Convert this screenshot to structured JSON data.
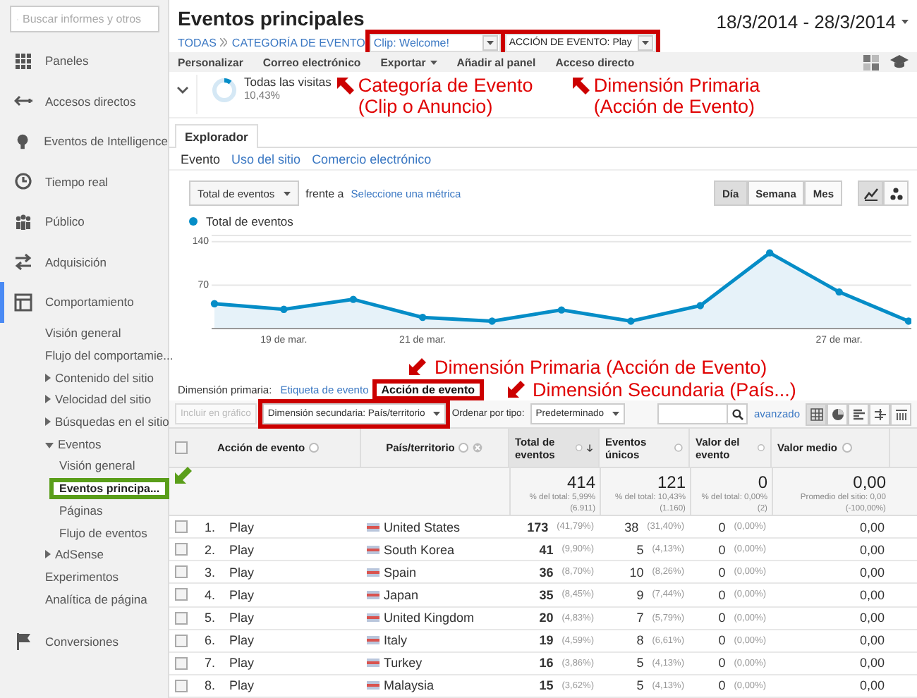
{
  "sidebar": {
    "search": {
      "placeholder": "Buscar informes y otros"
    },
    "items": [
      {
        "label": "Paneles",
        "selected": false
      },
      {
        "label": "Accesos directos",
        "selected": false
      },
      {
        "label": "Eventos de Intelligence",
        "selected": false
      },
      {
        "label": "Tiempo real",
        "selected": false
      },
      {
        "label": "Público",
        "selected": false
      },
      {
        "label": "Adquisición",
        "selected": false
      },
      {
        "label": "Comportamiento",
        "selected": true,
        "children": [
          {
            "label": "Visión general",
            "selected": false
          },
          {
            "label": "Flujo del comportamie...",
            "selected": false
          },
          {
            "label": "Contenido del sitio",
            "selected": false,
            "expanded": false
          },
          {
            "label": "Velocidad del sitio",
            "selected": false,
            "expanded": false
          },
          {
            "label": "Búsquedas en el sitio",
            "selected": false,
            "expanded": false
          },
          {
            "label": "Eventos",
            "selected": false,
            "expanded": true,
            "children": [
              {
                "label": "Visión general",
                "selected": false
              },
              {
                "label": "Eventos principa...",
                "selected": true,
                "highlighted": true
              },
              {
                "label": "Páginas",
                "selected": false
              },
              {
                "label": "Flujo de eventos",
                "selected": false
              }
            ]
          },
          {
            "label": "AdSense",
            "selected": false,
            "expanded": false
          },
          {
            "label": "Experimentos",
            "selected": false
          },
          {
            "label": "Analítica de página",
            "selected": false
          }
        ]
      },
      {
        "label": "Conversiones",
        "selected": false
      }
    ]
  },
  "header": {
    "title": "Eventos principales",
    "date_range": "18/3/2014 - 28/3/2014",
    "breadcrumb": [
      {
        "label": "TODAS",
        "kind": "link",
        "highlighted": false
      },
      {
        "label": "CATEGORÍA DE EVENTO",
        "kind": "link",
        "highlighted": false
      },
      {
        "label": "Clip: Welcome!",
        "kind": "dropdown",
        "highlighted": true
      },
      {
        "label": "ACCIÓN DE EVENTO: Play",
        "kind": "dropdown",
        "highlighted": true
      }
    ]
  },
  "toolbar": {
    "actions": [
      {
        "label": "Personalizar",
        "kind": "button"
      },
      {
        "label": "Correo electrónico",
        "kind": "button"
      },
      {
        "label": "Exportar",
        "kind": "menu"
      },
      {
        "label": "Añadir al panel",
        "kind": "button"
      },
      {
        "label": "Acceso directo",
        "kind": "button"
      }
    ]
  },
  "segment": {
    "label": "Todas las visitas",
    "value": "10,43%",
    "level": 0.1043,
    "notes": [
      {
        "text": "Categoría de Evento (Clip o Anuncio)"
      },
      {
        "text": "Dimensión Primaria (Acción de Evento)"
      }
    ]
  },
  "tabs": [
    {
      "label": "Explorador",
      "selected": true
    }
  ],
  "subtabs": [
    {
      "label": "Evento",
      "selected": true
    },
    {
      "label": "Uso del sitio",
      "selected": false
    },
    {
      "label": "Comercio electrónico",
      "selected": false
    }
  ],
  "chart_controls": {
    "metric": "Total de eventos",
    "versus": "frente a",
    "add_metric": "Seleccione una métrica",
    "periods": [
      {
        "label": "Día",
        "selected": true
      },
      {
        "label": "Semana",
        "selected": false
      },
      {
        "label": "Mes",
        "selected": false
      }
    ],
    "chart_types": [
      {
        "kind": "line",
        "selected": true
      },
      {
        "kind": "motion",
        "selected": false
      }
    ]
  },
  "chart": {
    "chart_data": {
      "type": "area",
      "categories": [
        null,
        "19 de mar.",
        null,
        "21 de mar.",
        null,
        null,
        null,
        null,
        null,
        "27 de mar.",
        null
      ],
      "series": [
        {
          "name": "Total de eventos",
          "color": "#058dc7",
          "values": [
            40,
            31,
            47,
            18,
            12,
            30,
            12,
            37,
            122,
            59,
            12
          ]
        }
      ],
      "ylim": [
        0,
        150
      ],
      "yticks": [
        70,
        140
      ]
    }
  },
  "dimension": {
    "label": "Dimensión primaria:",
    "options": [
      {
        "label": "Etiqueta de evento",
        "selected": false,
        "highlighted": false
      },
      {
        "label": "Acción de evento",
        "selected": true,
        "highlighted": true
      }
    ],
    "notes": [
      {
        "text": "Dimensión Primaria (Acción de Evento)"
      },
      {
        "text": "Dimensión Secundaria (País...)"
      }
    ]
  },
  "table_controls": {
    "plot_rows": {
      "label": "Incluir en gráfico",
      "disabled": true
    },
    "secondary": {
      "label": "Dimensión secundaria: País/territorio",
      "highlighted": true
    },
    "sort_label": "Ordenar por tipo:",
    "sort_value": "Predeterminado",
    "advanced": "avanzado",
    "views": [
      {
        "kind": "table",
        "selected": true
      },
      {
        "kind": "pie",
        "selected": false
      },
      {
        "kind": "bars",
        "selected": false
      },
      {
        "kind": "comparison",
        "selected": false
      },
      {
        "kind": "pivot",
        "selected": false
      }
    ]
  },
  "table": {
    "all_checked": false,
    "columns": [
      {
        "label": "Acción de evento",
        "sorted": false
      },
      {
        "label": "País/territorio",
        "sorted": false,
        "removable": true
      },
      {
        "label": "Total de eventos",
        "sorted": true
      },
      {
        "label": "Eventos únicos",
        "sorted": false
      },
      {
        "label": "Valor del evento",
        "sorted": false
      },
      {
        "label": "Valor medio",
        "sorted": false
      }
    ],
    "totals": [
      {
        "value": "414",
        "share": "% del total: 5,99%",
        "base": "(6.911)"
      },
      {
        "value": "121",
        "share": "% del total: 10,43%",
        "base": "(1.160)"
      },
      {
        "value": "0",
        "share": "% del total: 0,00%",
        "base": "(2)"
      },
      {
        "value": "0,00",
        "share": "Promedio del sitio: 0,00",
        "base": "(-100,00%)"
      }
    ],
    "rows": [
      {
        "checked": false,
        "index": "1.",
        "action": "Play",
        "country": "United States",
        "total": "173",
        "total_pct": "(41,79%)",
        "unique": "38",
        "unique_pct": "(31,40%)",
        "value": "0",
        "value_pct": "(0,00%)",
        "avg": "0,00"
      },
      {
        "checked": false,
        "index": "2.",
        "action": "Play",
        "country": "South Korea",
        "total": "41",
        "total_pct": "(9,90%)",
        "unique": "5",
        "unique_pct": "(4,13%)",
        "value": "0",
        "value_pct": "(0,00%)",
        "avg": "0,00"
      },
      {
        "checked": false,
        "index": "3.",
        "action": "Play",
        "country": "Spain",
        "total": "36",
        "total_pct": "(8,70%)",
        "unique": "10",
        "unique_pct": "(8,26%)",
        "value": "0",
        "value_pct": "(0,00%)",
        "avg": "0,00"
      },
      {
        "checked": false,
        "index": "4.",
        "action": "Play",
        "country": "Japan",
        "total": "35",
        "total_pct": "(8,45%)",
        "unique": "9",
        "unique_pct": "(7,44%)",
        "value": "0",
        "value_pct": "(0,00%)",
        "avg": "0,00"
      },
      {
        "checked": false,
        "index": "5.",
        "action": "Play",
        "country": "United Kingdom",
        "total": "20",
        "total_pct": "(4,83%)",
        "unique": "7",
        "unique_pct": "(5,79%)",
        "value": "0",
        "value_pct": "(0,00%)",
        "avg": "0,00"
      },
      {
        "checked": false,
        "index": "6.",
        "action": "Play",
        "country": "Italy",
        "total": "19",
        "total_pct": "(4,59%)",
        "unique": "8",
        "unique_pct": "(6,61%)",
        "value": "0",
        "value_pct": "(0,00%)",
        "avg": "0,00"
      },
      {
        "checked": false,
        "index": "7.",
        "action": "Play",
        "country": "Turkey",
        "total": "16",
        "total_pct": "(3,86%)",
        "unique": "5",
        "unique_pct": "(4,13%)",
        "value": "0",
        "value_pct": "(0,00%)",
        "avg": "0,00"
      },
      {
        "checked": false,
        "index": "8.",
        "action": "Play",
        "country": "Malaysia",
        "total": "15",
        "total_pct": "(3,62%)",
        "unique": "5",
        "unique_pct": "(4,13%)",
        "value": "0",
        "value_pct": "(0,00%)",
        "avg": "0,00"
      }
    ]
  }
}
